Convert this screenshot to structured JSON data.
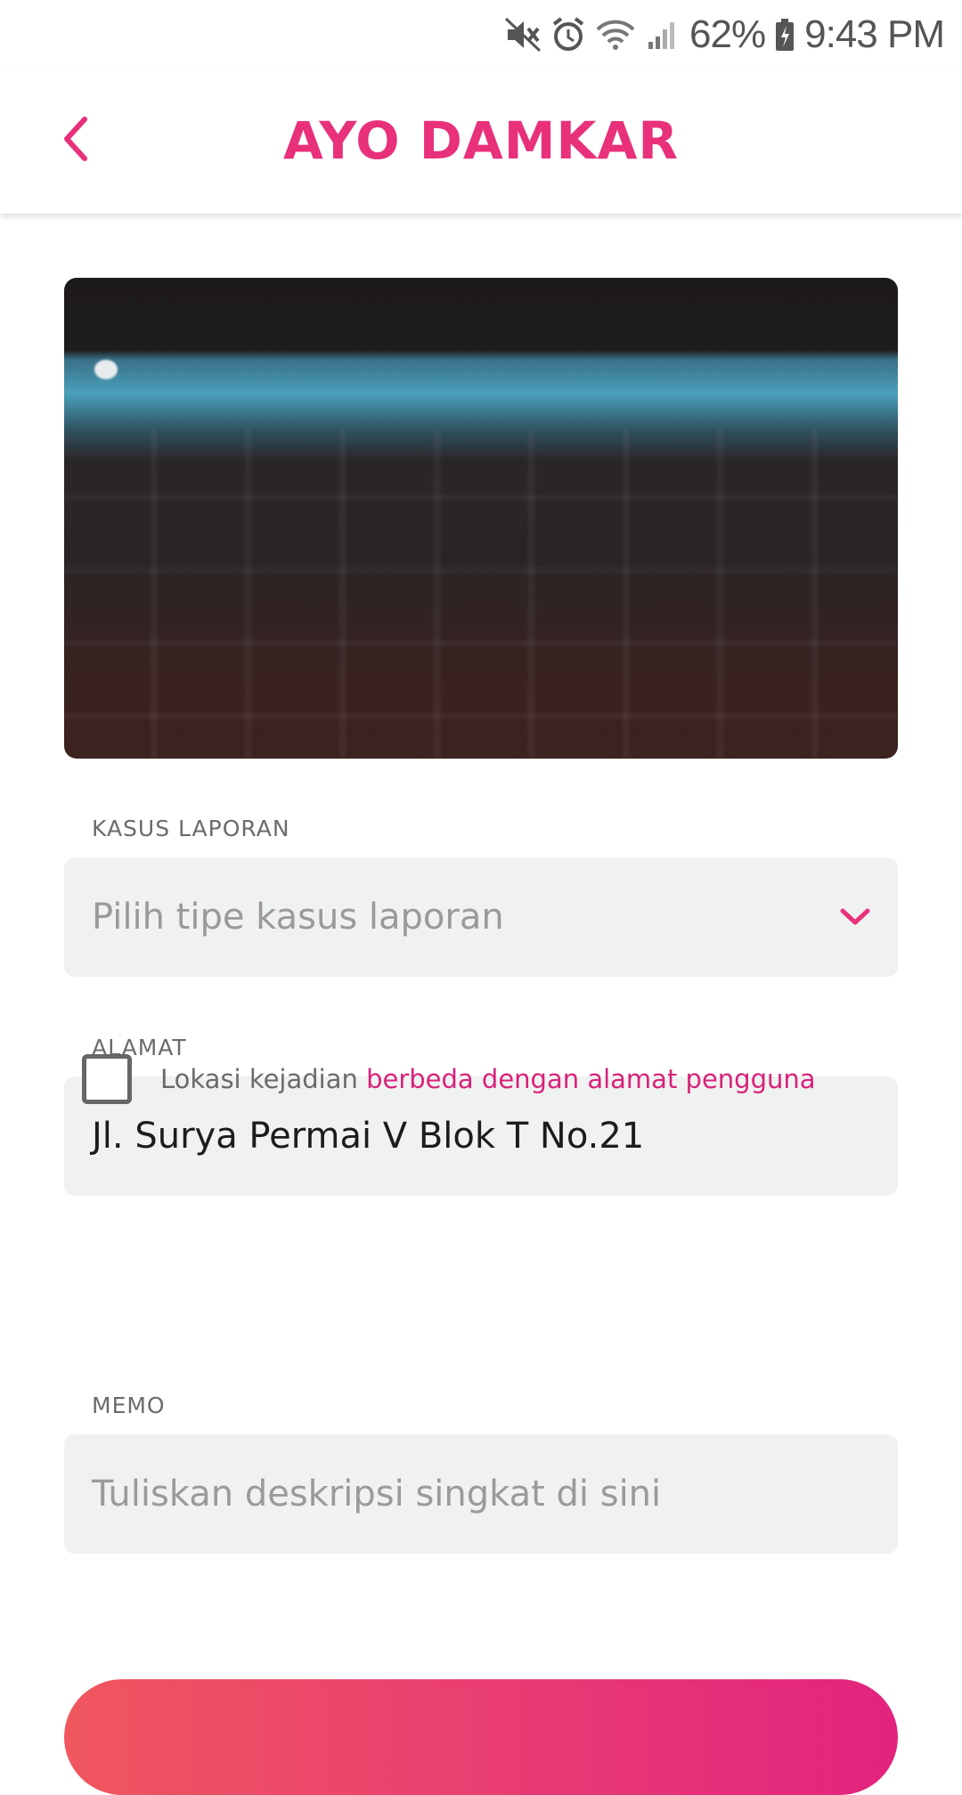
{
  "status_bar": {
    "icons": [
      "mute-icon",
      "alarm-icon",
      "wifi-icon",
      "signal-icon",
      "battery-charging-icon"
    ],
    "battery": "62%",
    "time": "9:43 PM"
  },
  "header": {
    "title": "AYO DAMKAR",
    "back_icon": "chevron-left-icon",
    "accent_color": "#e8317a"
  },
  "photo": {
    "description_icon": "photo"
  },
  "form": {
    "case": {
      "label": "KASUS LAPORAN",
      "placeholder": "Pilih tipe kasus laporan",
      "dropdown_icon": "chevron-down-icon"
    },
    "address": {
      "label": "ALAMAT",
      "value": "Jl. Surya Permai V Blok T No.21"
    },
    "location_checkbox": {
      "checked": false,
      "text_prefix": "Lokasi kejadian ",
      "text_link": "berbeda dengan alamat pengguna"
    },
    "memo": {
      "label": "MEMO",
      "placeholder": "Tuliskan deskripsi singkat di sini"
    }
  },
  "colors": {
    "accent": "#e8317a",
    "link": "#d8227a",
    "field_bg": "#f0f1f1",
    "button_gradient_start": "#f0575e",
    "button_gradient_end": "#e2237f"
  }
}
